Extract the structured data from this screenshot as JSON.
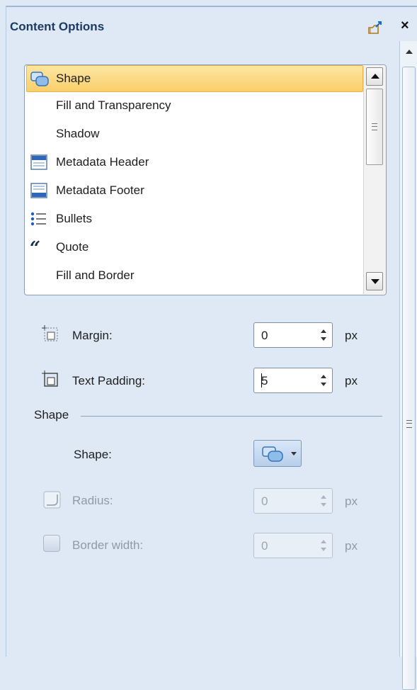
{
  "pane": {
    "title": "Content Options",
    "pin_icon": "pin-icon",
    "close_label": "×"
  },
  "list": {
    "items": [
      {
        "label": "Shape",
        "icon": "shape-icon",
        "selected": true
      },
      {
        "label": "Fill and Transparency",
        "icon": null
      },
      {
        "label": "Shadow",
        "icon": null
      },
      {
        "label": "Metadata Header",
        "icon": "metadata-header-icon"
      },
      {
        "label": "Metadata Footer",
        "icon": "metadata-footer-icon"
      },
      {
        "label": "Bullets",
        "icon": "bullets-icon"
      },
      {
        "label": "Quote",
        "icon": "quote-icon"
      },
      {
        "label": "Fill and Border",
        "icon": null
      }
    ]
  },
  "margin": {
    "label": "Margin:",
    "value": "0",
    "unit": "px"
  },
  "text_padding": {
    "label": "Text Padding:",
    "value": "5",
    "unit": "px"
  },
  "shape_group": {
    "title": "Shape",
    "shape_label": "Shape:",
    "radius": {
      "label": "Radius:",
      "value": "0",
      "unit": "px",
      "enabled": false
    },
    "border_width": {
      "label": "Border width:",
      "value": "0",
      "unit": "px",
      "enabled": false
    }
  },
  "colors": {
    "pane_bg": "#dfe9f5",
    "title": "#1b3a64",
    "selection": "#f9cf6a",
    "disabled_text": "#8f9aa8"
  }
}
